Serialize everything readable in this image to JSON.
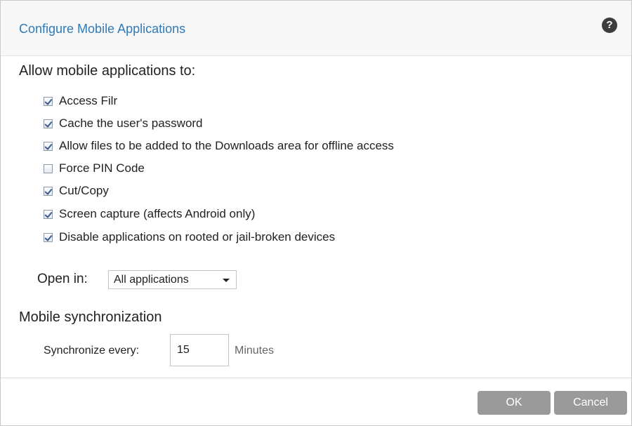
{
  "dialog": {
    "title": "Configure Mobile Applications",
    "help_icon": "question-mark-circle-icon",
    "help_glyph": "?"
  },
  "permissions": {
    "heading": "Allow mobile applications to:",
    "options": [
      {
        "label": "Access Filr",
        "checked": true
      },
      {
        "label": "Cache the user's password",
        "checked": true
      },
      {
        "label": "Allow files to be added to the Downloads area for offline access",
        "checked": true
      },
      {
        "label": "Force PIN Code",
        "checked": false
      },
      {
        "label": "Cut/Copy",
        "checked": true
      },
      {
        "label": "Screen capture (affects Android only)",
        "checked": true
      },
      {
        "label": "Disable applications on rooted or jail-broken devices",
        "checked": true
      }
    ]
  },
  "open_in": {
    "label": "Open in:",
    "selected": "All applications"
  },
  "sync": {
    "heading": "Mobile synchronization",
    "label": "Synchronize every:",
    "value": "15",
    "unit": "Minutes"
  },
  "footer": {
    "ok_label": "OK",
    "cancel_label": "Cancel"
  },
  "colors": {
    "title": "#2f7ab8",
    "button_bg": "#9a9a9a",
    "header_bg": "#f7f7f7"
  }
}
